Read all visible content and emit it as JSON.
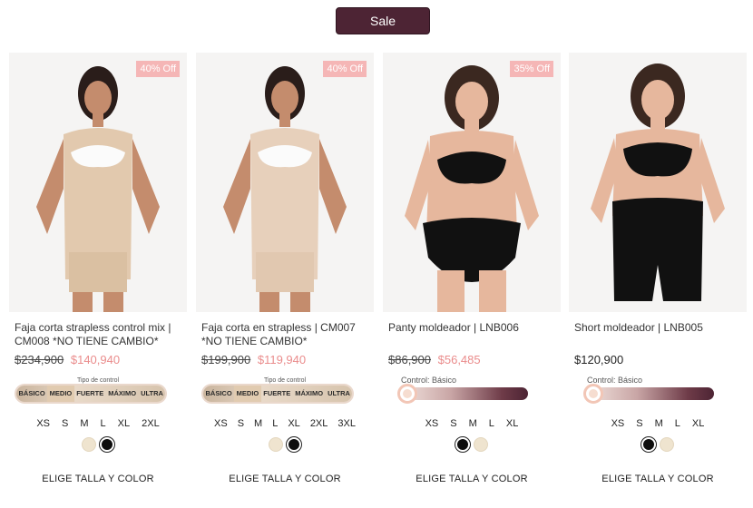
{
  "header": {
    "sale_label": "Sale"
  },
  "products": [
    {
      "badge": "40% Off",
      "name": "Faja corta strapless control mix | CM008 *NO TIENE CAMBIO*",
      "old_price": "$234,900",
      "price": "$140,940",
      "control_title": "Tipo de control",
      "control_levels": [
        "BÁSICO",
        "MEDIO",
        "FUERTE",
        "MÁXIMO",
        "ULTRA"
      ],
      "sizes": [
        "XS",
        "S",
        "M",
        "L",
        "XL",
        "2XL"
      ],
      "colors": [
        "nude",
        "black"
      ],
      "cta": "ELIGE TALLA Y COLOR"
    },
    {
      "badge": "40% Off",
      "name": "Faja corta en strapless | CM007 *NO TIENE CAMBIO*",
      "old_price": "$199,900",
      "price": "$119,940",
      "control_title": "Tipo de control",
      "control_levels": [
        "BÁSICO",
        "MEDIO",
        "FUERTE",
        "MÁXIMO",
        "ULTRA"
      ],
      "sizes": [
        "XS",
        "S",
        "M",
        "L",
        "XL",
        "2XL",
        "3XL"
      ],
      "colors": [
        "nude",
        "black"
      ],
      "cta": "ELIGE TALLA Y COLOR"
    },
    {
      "badge": "35% Off",
      "name": "Panty moldeador | LNB006",
      "old_price": "$86,900",
      "price": "$56,485",
      "control_label": "Control: Básico",
      "sizes": [
        "XS",
        "S",
        "M",
        "L",
        "XL"
      ],
      "colors": [
        "black",
        "nude"
      ],
      "cta": "ELIGE TALLA Y COLOR"
    },
    {
      "name": "Short moldeador | LNB005",
      "price": "$120,900",
      "control_label": "Control: Básico",
      "sizes": [
        "XS",
        "S",
        "M",
        "L",
        "XL"
      ],
      "colors": [
        "black",
        "nude"
      ],
      "cta": "ELIGE TALLA Y COLOR"
    }
  ],
  "colors": {
    "brand": "#4d2434",
    "sale_price": "#ea8c8c",
    "badge": "#f5b6b6"
  }
}
